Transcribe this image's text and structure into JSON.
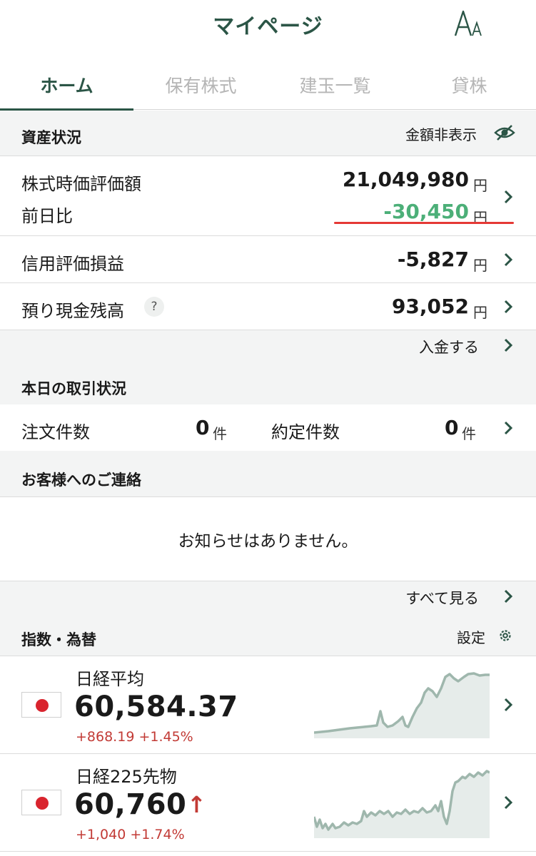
{
  "header": {
    "title": "マイページ",
    "font_size_button_label": "A"
  },
  "tabs": [
    {
      "label": "ホーム",
      "active": true
    },
    {
      "label": "保有株式",
      "active": false
    },
    {
      "label": "建玉一覧",
      "active": false
    },
    {
      "label": "貸株",
      "active": false
    }
  ],
  "assets": {
    "section_label": "資産状況",
    "hide_amount_label": "金額非表示",
    "stock_value_label": "株式時価評価額",
    "stock_value": "21,049,980",
    "prev_day_label": "前日比",
    "prev_day_value": "-30,450",
    "margin_pl_label": "信用評価損益",
    "margin_pl_value": "-5,827",
    "cash_label": "預り現金残高",
    "cash_value": "93,052",
    "help_label": "?",
    "deposit_label": "入金する",
    "yen": "円"
  },
  "trading": {
    "section_label": "本日の取引状況",
    "orders_label": "注文件数",
    "orders_value": "0",
    "executions_label": "約定件数",
    "executions_value": "0",
    "unit": "件"
  },
  "notices": {
    "section_label": "お客様へのご連絡",
    "empty_message": "お知らせはありません。",
    "see_all_label": "すべて見る"
  },
  "indices": {
    "section_label": "指数・為替",
    "settings_label": "設定",
    "items": [
      {
        "name": "日経平均",
        "value": "60,584.37",
        "change": "+868.19 +1.45%",
        "arrow": ""
      },
      {
        "name": "日経225先物",
        "value": "60,760",
        "change": "+1,040 +1.74%",
        "arrow": "↑"
      }
    ]
  },
  "colors": {
    "brand": "#2b5546",
    "negative_change": "#4caf78",
    "positive_change": "#c23a35",
    "underline_highlight": "#e53935",
    "sparkline": "#9fb7ad"
  }
}
